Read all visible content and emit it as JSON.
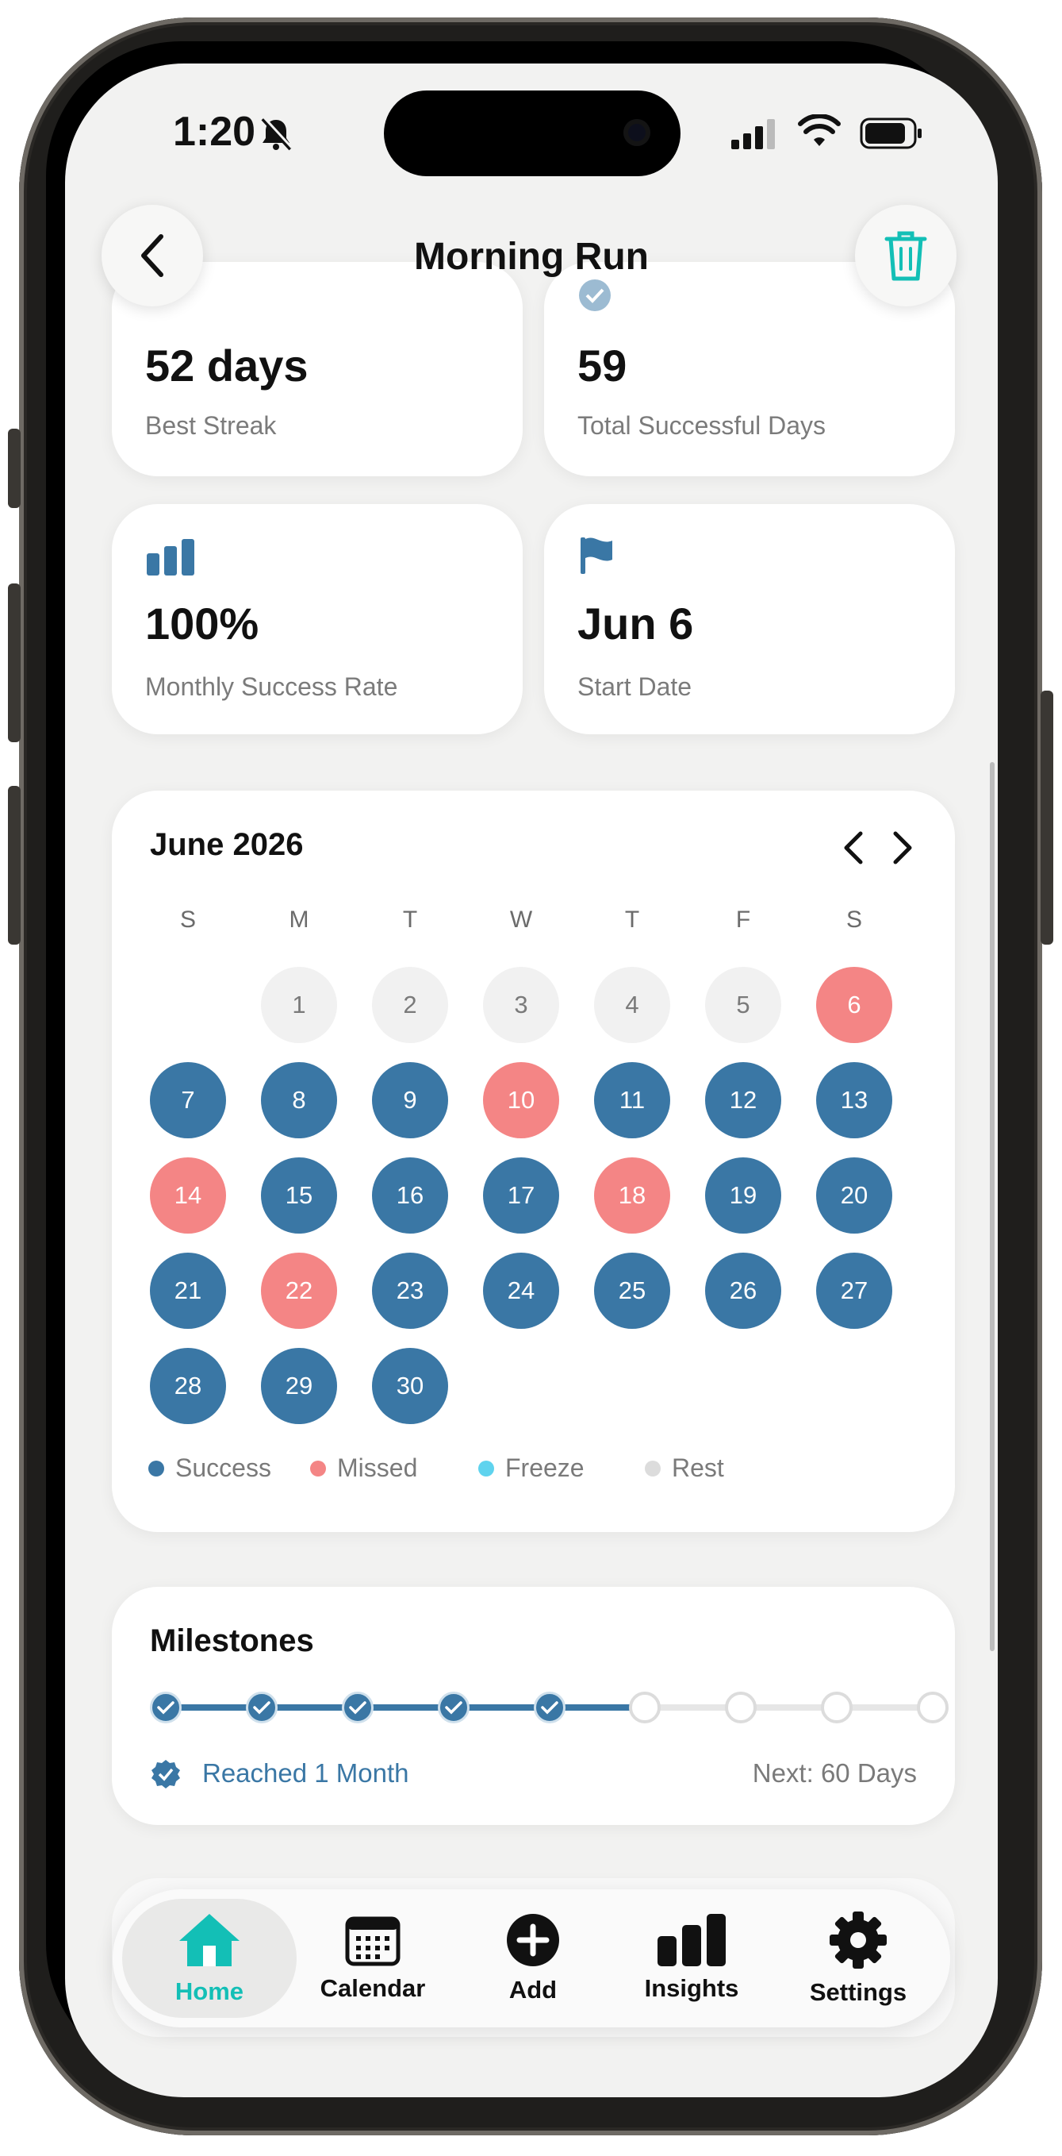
{
  "status_bar": {
    "time": "1:20"
  },
  "header": {
    "title": "Morning Run"
  },
  "stats": [
    {
      "value": "52 days",
      "label": "Best Streak"
    },
    {
      "value": "59",
      "label": "Total Successful Days"
    },
    {
      "value": "100%",
      "label": "Monthly Success Rate"
    },
    {
      "value": "Jun 6",
      "label": "Start Date"
    }
  ],
  "calendar": {
    "month_title": "June 2026",
    "weekdays": [
      "S",
      "M",
      "T",
      "W",
      "T",
      "F",
      "S"
    ],
    "days": [
      {
        "d": "1",
        "s": "rest"
      },
      {
        "d": "2",
        "s": "rest"
      },
      {
        "d": "3",
        "s": "rest"
      },
      {
        "d": "4",
        "s": "rest"
      },
      {
        "d": "5",
        "s": "rest"
      },
      {
        "d": "6",
        "s": "missed"
      },
      {
        "d": "7",
        "s": "success"
      },
      {
        "d": "8",
        "s": "success"
      },
      {
        "d": "9",
        "s": "success"
      },
      {
        "d": "10",
        "s": "missed"
      },
      {
        "d": "11",
        "s": "success"
      },
      {
        "d": "12",
        "s": "success"
      },
      {
        "d": "13",
        "s": "success"
      },
      {
        "d": "14",
        "s": "missed"
      },
      {
        "d": "15",
        "s": "success"
      },
      {
        "d": "16",
        "s": "success"
      },
      {
        "d": "17",
        "s": "success"
      },
      {
        "d": "18",
        "s": "missed"
      },
      {
        "d": "19",
        "s": "success"
      },
      {
        "d": "20",
        "s": "success"
      },
      {
        "d": "21",
        "s": "success"
      },
      {
        "d": "22",
        "s": "missed"
      },
      {
        "d": "23",
        "s": "success"
      },
      {
        "d": "24",
        "s": "success"
      },
      {
        "d": "25",
        "s": "success"
      },
      {
        "d": "26",
        "s": "success"
      },
      {
        "d": "27",
        "s": "success"
      },
      {
        "d": "28",
        "s": "success"
      },
      {
        "d": "29",
        "s": "success"
      },
      {
        "d": "30",
        "s": "success"
      }
    ],
    "legend": [
      {
        "label": "Success",
        "color": "#3a77a5"
      },
      {
        "label": "Missed",
        "color": "#f48585"
      },
      {
        "label": "Freeze",
        "color": "#5fd3ee"
      },
      {
        "label": "Rest",
        "color": "#dcdcdc"
      }
    ]
  },
  "milestones": {
    "title": "Milestones",
    "completed": 5,
    "total": 9,
    "reached_label": "Reached 1 Month",
    "next_label": "Next: 60 Days"
  },
  "tab_bar": {
    "items": [
      {
        "label": "Home",
        "icon": "home-icon",
        "active": true
      },
      {
        "label": "Calendar",
        "icon": "calendar-icon",
        "active": false
      },
      {
        "label": "Add",
        "icon": "add-icon",
        "active": false
      },
      {
        "label": "Insights",
        "icon": "insights-icon",
        "active": false
      },
      {
        "label": "Settings",
        "icon": "gear-icon",
        "active": false
      }
    ]
  },
  "colors": {
    "accent": "#13bfb6",
    "success": "#3a77a5",
    "missed": "#f48585",
    "freeze": "#5fd3ee"
  }
}
